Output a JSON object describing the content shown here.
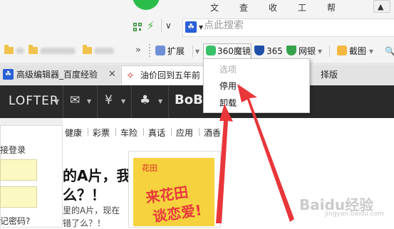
{
  "menubar": {
    "items": [
      "文件",
      "查看",
      "收藏",
      "工具",
      "帮助"
    ],
    "menu_icon": "shirt-icon"
  },
  "address": {
    "search_placeholder": "点此搜索",
    "search_engine_icon": "baidu-paw-icon",
    "qr_icon": "qr-code-icon",
    "speed_icon": "lightning-icon"
  },
  "bookmarks": {
    "more_glyph": "»",
    "extensions": [
      {
        "label": "扩展",
        "icon": "puzzle-icon"
      },
      {
        "label": "360魔镜",
        "icon": "mirror-icon"
      },
      {
        "label": "365",
        "icon": "shield-icon"
      },
      {
        "label": "网银",
        "icon": "bank-shield-icon"
      },
      {
        "label": "截图",
        "icon": "scissors-icon"
      }
    ]
  },
  "tabs": [
    {
      "label": "高级编辑器_百度经验"
    },
    {
      "label": "油价回到五年前"
    },
    {
      "label": "择版"
    }
  ],
  "lofter": {
    "logo": "LOFTER",
    "bobo": "BoBo"
  },
  "login": {
    "title": "接登录",
    "forgot": "记密码?"
  },
  "news_nav": [
    "健康",
    "彩票",
    "车险",
    "真话",
    "应用",
    "酒香"
  ],
  "article": {
    "headline_line1": "的A片，我",
    "headline_line2": "么？！",
    "snippet_line1": "里的A片，现在",
    "snippet_line2": "错了么？！"
  },
  "ad": {
    "brand": "花田",
    "line1": "来花田",
    "line2": "谈恋爱!"
  },
  "context_menu": {
    "header": "选项",
    "items": [
      "停用",
      "卸载"
    ]
  },
  "watermark": {
    "main": "Baidu经验",
    "sub": "jingyan.baidu.com"
  },
  "colors": {
    "accent_green": "#2bbd4a",
    "arrow_red": "#e8363b",
    "lofter_bg": "#2a2a2a"
  }
}
